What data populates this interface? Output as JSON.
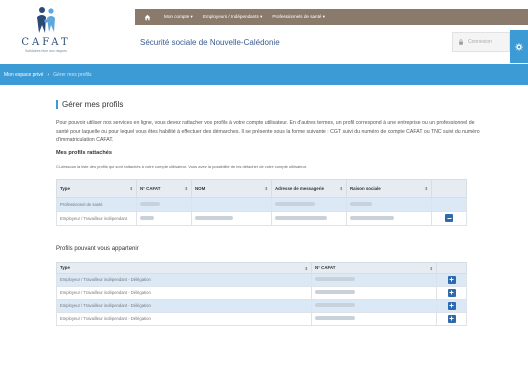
{
  "header": {
    "logo_text": "CAFAT",
    "logo_tagline": "Solidaires face aux risques",
    "subtitle": "Sécurité sociale de Nouvelle-Calédonie",
    "login_label": "Connexion",
    "colors": {
      "nav": "#8a7a6c",
      "accent": "#3c9ad4",
      "logo": "#2b4a78"
    }
  },
  "topnav": {
    "items": [
      {
        "label": "Mon compte"
      },
      {
        "label": "Employeurs / Indépendants"
      },
      {
        "label": "Professionnels de santé"
      }
    ]
  },
  "breadcrumb": {
    "root": "Mon espace privé",
    "current": "Gérer mes profils"
  },
  "main": {
    "title": "Gérer mes profils",
    "intro": "Pour pouvoir utiliser nos services en ligne, vous devez rattacher vos profils à votre compte utilisateur. En d'autres termes, un profil correspond à une entreprise ou un professionnel de santé pour laquelle ou pour lequel vous êtes habilité à effectuer des démarches. Il se présente sous la forme suivante : CGT suivi du numéro de compte CAFAT ou TNC suivi du numéro d'immatriculation CAFAT.",
    "attached_title": "Mes profils rattachés",
    "attached_note": "Ci-dessous la liste des profils qui sont rattachés à votre compte utilisateur. Vous avez la possibilité de les détacher de votre compte utilisateur.",
    "attached_table": {
      "headers": [
        "Type",
        "N° CAFAT",
        "NOM",
        "Adresse de messagerie",
        "Raison sociale"
      ],
      "rows": [
        {
          "type": "Professionnel de santé"
        },
        {
          "type": "Employeur / Travailleur indépendant"
        }
      ]
    },
    "available_title": "Profils pouvant vous appartenir",
    "available_table": {
      "headers": [
        "Type",
        "N° CAFAT"
      ],
      "rows": [
        {
          "type": "Employeur / Travailleur indépendant - Délégation"
        },
        {
          "type": "Employeur / Travailleur indépendant - Délégation"
        },
        {
          "type": "Employeur / Travailleur indépendant - Délégation"
        },
        {
          "type": "Employeur / Travailleur indépendant - Délégation"
        }
      ]
    }
  }
}
